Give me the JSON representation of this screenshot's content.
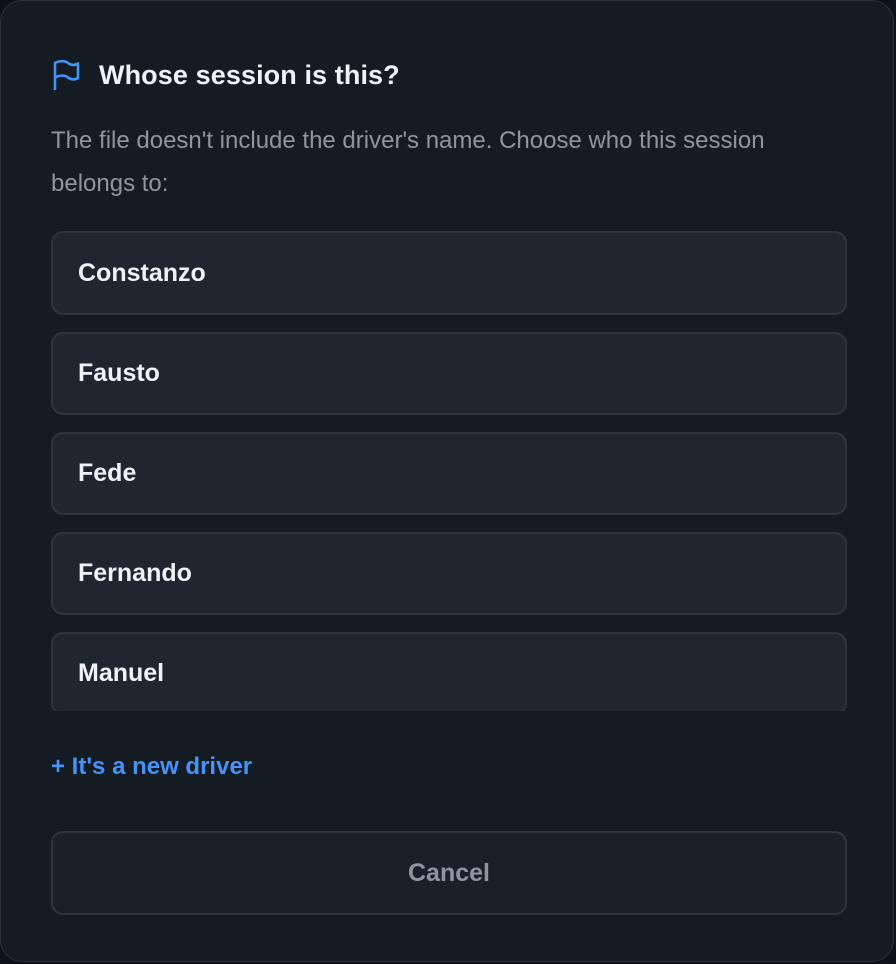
{
  "dialog": {
    "icon": "flag-icon",
    "title": "Whose session is this?",
    "description": "The file doesn't include the driver's name. Choose who this session belongs to:",
    "drivers": [
      {
        "label": "Constanzo"
      },
      {
        "label": "Fausto"
      },
      {
        "label": "Fede"
      },
      {
        "label": "Fernando"
      },
      {
        "label": "Manuel"
      }
    ],
    "new_driver_label": "+ It's a new driver",
    "cancel_label": "Cancel"
  },
  "colors": {
    "background": "#151b23",
    "item_background": "#1f2630",
    "border": "#2d3440",
    "text_primary": "#f0f3f6",
    "text_muted": "#8d96a0",
    "accent": "#4493f8"
  }
}
